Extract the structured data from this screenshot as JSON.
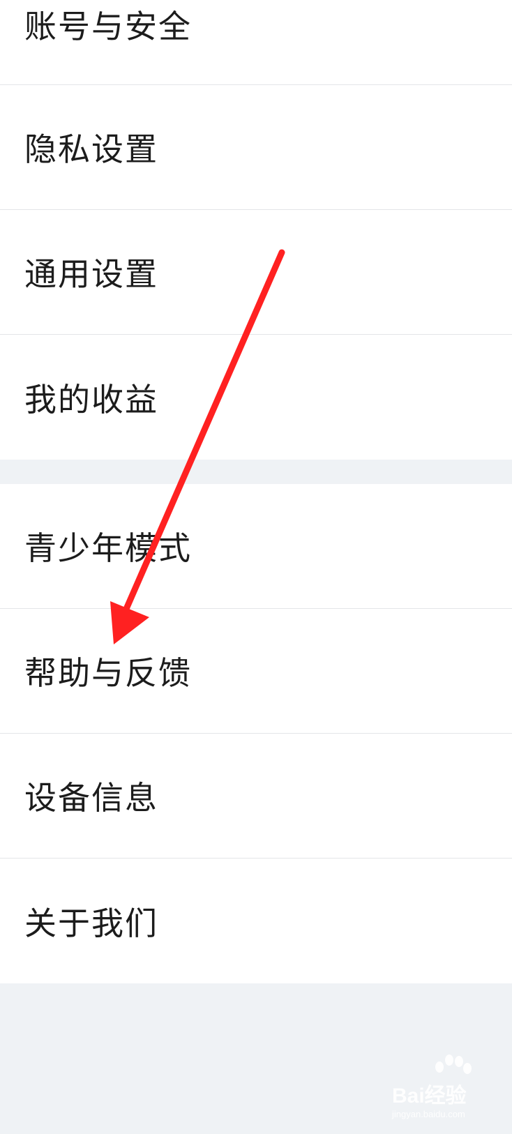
{
  "settings_group_1": {
    "items": [
      {
        "label": "账号与安全"
      },
      {
        "label": "隐私设置"
      },
      {
        "label": "通用设置"
      },
      {
        "label": "我的收益"
      }
    ]
  },
  "settings_group_2": {
    "items": [
      {
        "label": "青少年模式"
      },
      {
        "label": "帮助与反馈"
      },
      {
        "label": "设备信息"
      },
      {
        "label": "关于我们"
      }
    ]
  },
  "annotation": {
    "arrow_color": "#ff2121",
    "arrow_target": "帮助与反馈"
  },
  "watermark": {
    "text": "Bai经验",
    "sub": "jingyan.baidu.com"
  },
  "colors": {
    "background": "#eff2f5",
    "card": "#ffffff",
    "divider": "#e3e5e8",
    "text": "#1c1c1c"
  }
}
